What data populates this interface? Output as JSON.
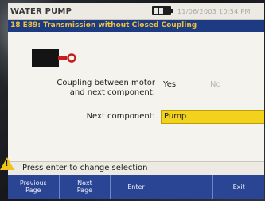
{
  "header": {
    "app_title": "WATER PUMP",
    "datetime": "11/06/2003 10:54 PM"
  },
  "question": {
    "text": "18 E89: Transmission without Closed Coupling"
  },
  "form": {
    "coupling_label_line1": "Coupling between motor",
    "coupling_label_line2": "and next component:",
    "coupling_yes": "Yes",
    "coupling_no": "No",
    "next_component_label": "Next component:",
    "next_component_value": "Pump"
  },
  "hint": {
    "text": "Press enter to change selection"
  },
  "softkeys": [
    {
      "label": "Previous\nPage"
    },
    {
      "label": "Next\nPage"
    },
    {
      "label": "Enter"
    },
    {
      "label": ""
    },
    {
      "label": "Exit"
    }
  ],
  "colors": {
    "question_bar": "#1c3b82",
    "question_text": "#f0c23c",
    "selection": "#f2d21c",
    "softkey_bar": "#2a4594"
  }
}
